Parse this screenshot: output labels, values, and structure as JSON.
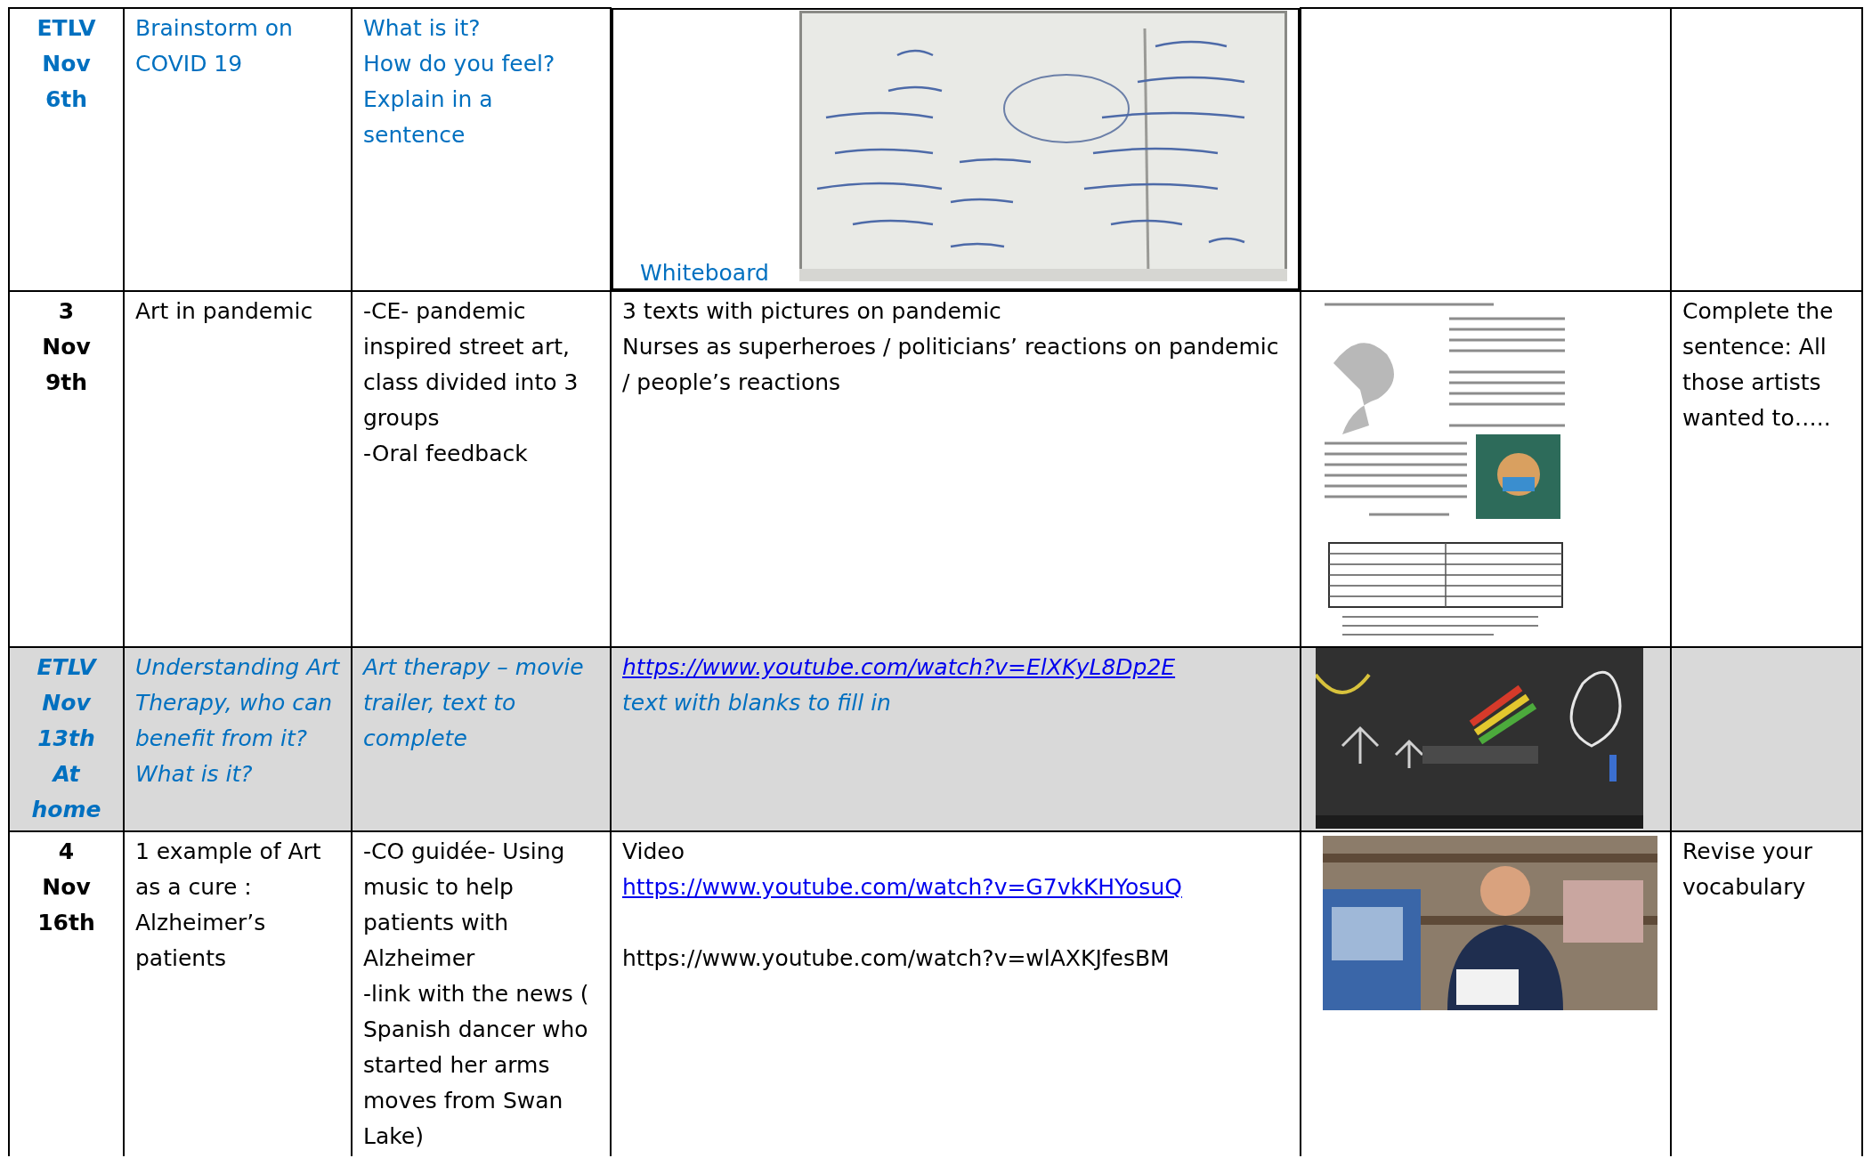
{
  "rows": [
    {
      "kind": "etlv",
      "date": [
        "ETLV",
        "Nov",
        "6th"
      ],
      "topic": [
        "Brainstorm on COVID 19"
      ],
      "activity": [
        "What is it?",
        "How do you feel?",
        "Explain in a sentence"
      ],
      "picture_caption": "Whiteboard",
      "resources_picture": {
        "kind": "picture"
      }
    },
    {
      "kind": "lesson",
      "date": [
        "3",
        "Nov",
        "9th"
      ],
      "topic": [
        "Art in pandemic"
      ],
      "activity": [
        "-CE- pandemic inspired street art, class divided into 3 groups",
        "-Oral feedback"
      ],
      "resources": [
        [
          {
            "kind": "text",
            "text": "3 texts with pictures on pandemic"
          },
          {
            "kind": "text",
            "text": "Nurses as superheroes / politicians’ reactions on pandemic / people’s reactions"
          }
        ]
      ],
      "media": {
        "kind": "picture"
      },
      "homework": [
        "Complete the sentence: All those artists wanted to….."
      ]
    },
    {
      "kind": "etlv_home",
      "date": [
        "ETLV",
        "Nov",
        "13th",
        "At",
        "home"
      ],
      "topic": [
        "Understanding Art Therapy, who can benefit from it?",
        "What is it?"
      ],
      "activity": [
        "Art therapy – movie trailer, text to complete"
      ],
      "resources": [
        [
          {
            "kind": "link",
            "text": "https://www.youtube.com/watch?v=ElXKyL8Dp2E"
          },
          {
            "kind": "text",
            "text": "text with blanks to fill in"
          }
        ]
      ],
      "media": {
        "kind": "picture"
      }
    },
    {
      "kind": "lesson",
      "date": [
        "4",
        "Nov",
        "16th"
      ],
      "topic": [
        "1 example of Art as a cure : Alzheimer’s patients"
      ],
      "activity": [
        "-CO guidée- Using music to help patients with Alzheimer",
        "-link with the news ( Spanish dancer who started her arms moves from Swan Lake)"
      ],
      "resources": [
        [
          {
            "kind": "text",
            "text": "Video"
          },
          {
            "kind": "link",
            "text": "https://www.youtube.com/watch?v=G7vkKHYosuQ"
          }
        ],
        [
          {
            "kind": "text",
            "text": "https://www.youtube.com/watch?v=wlAXKJfesBM"
          }
        ]
      ],
      "media": {
        "kind": "picture"
      },
      "homework": [
        "Revise your vocabulary"
      ]
    }
  ]
}
